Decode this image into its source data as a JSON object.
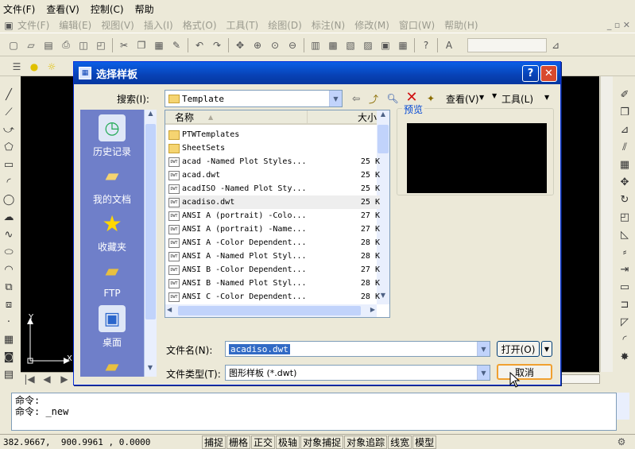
{
  "system_menu": [
    "文件(F)",
    "查看(V)",
    "控制(C)",
    "帮助"
  ],
  "app_menu": [
    "文件(F)",
    "编辑(E)",
    "视图(V)",
    "插入(I)",
    "格式(O)",
    "工具(T)",
    "绘图(D)",
    "标注(N)",
    "修改(M)",
    "窗口(W)",
    "帮助(H)"
  ],
  "dialog": {
    "title": "选择样板",
    "help_btn": "?",
    "close_btn": "✕",
    "search_label": "搜索(I):",
    "search_value": "Template",
    "view_label": "查看(V)",
    "tools_label": "工具(L)",
    "preview_label": "预览",
    "col_name": "名称",
    "col_size": "大小",
    "places": [
      "历史记录",
      "我的文档",
      "收藏夹",
      "FTP",
      "桌面"
    ],
    "files": [
      {
        "name": "PTWTemplates",
        "size": "",
        "kind": "folder"
      },
      {
        "name": "SheetSets",
        "size": "",
        "kind": "folder"
      },
      {
        "name": "acad -Named Plot Styles...",
        "size": "25 K",
        "kind": "dwt"
      },
      {
        "name": "acad.dwt",
        "size": "25 K",
        "kind": "dwt"
      },
      {
        "name": "acadISO -Named Plot Sty...",
        "size": "25 K",
        "kind": "dwt"
      },
      {
        "name": "acadiso.dwt",
        "size": "25 K",
        "kind": "dwt"
      },
      {
        "name": "ANSI A (portrait) -Colo...",
        "size": "27 K",
        "kind": "dwt"
      },
      {
        "name": "ANSI A (portrait) -Name...",
        "size": "27 K",
        "kind": "dwt"
      },
      {
        "name": "ANSI A -Color Dependent...",
        "size": "28 K",
        "kind": "dwt"
      },
      {
        "name": "ANSI A -Named Plot Styl...",
        "size": "28 K",
        "kind": "dwt"
      },
      {
        "name": "ANSI B -Color Dependent...",
        "size": "27 K",
        "kind": "dwt"
      },
      {
        "name": "ANSI B -Named Plot Styl...",
        "size": "28 K",
        "kind": "dwt"
      },
      {
        "name": "ANSI C -Color Dependent...",
        "size": "28 K",
        "kind": "dwt"
      }
    ],
    "filename_label": "文件名(N):",
    "filename_value": "acadiso.dwt",
    "filetype_label": "文件类型(T):",
    "filetype_value": "图形样板 (*.dwt)",
    "open_btn": "打开(O)",
    "cancel_btn": "取消"
  },
  "command": {
    "line1": "命令:",
    "line2": "命令: _new"
  },
  "status": {
    "coords": "382.9667,  900.9961 , 0.0000",
    "toggles": [
      "捕捉",
      "栅格",
      "正交",
      "极轴",
      "对象捕捉",
      "对象追踪",
      "线宽",
      "模型"
    ]
  },
  "ucs": {
    "y": "Y",
    "x": "X"
  },
  "colors": {
    "canvas": "#000000",
    "titlebar": "#0842b5",
    "places_bar": "#6f7fc9",
    "selected": "#316ac5"
  }
}
